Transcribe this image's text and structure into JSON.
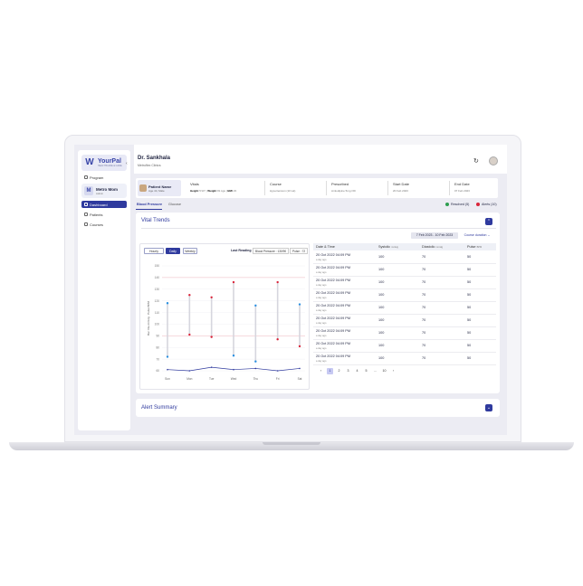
{
  "sidebar": {
    "logo_mark": "W",
    "logo_name": "YourPal",
    "logo_sub": "HEALTHCARE & CARE",
    "items": [
      {
        "label": "Program"
      },
      {
        "label": "Dashboard"
      },
      {
        "label": "Patients"
      },
      {
        "label": "Courses"
      }
    ],
    "org": {
      "initial": "M",
      "name": "Metro Mom",
      "sub": "Admin"
    }
  },
  "header": {
    "doctor": "Dr. Sankhala",
    "org": "Metroflex Clinics"
  },
  "patient": {
    "name": "Patient Name",
    "sub": "Age 44, Male",
    "vitals_label": "Vitals",
    "height_label": "Height",
    "height": "5'10\"",
    "weight_label": "Weight",
    "weight": "81 kgs",
    "bmi_label": "BMI",
    "bmi": "23",
    "course_label": "Course",
    "course": "Hypertension (10 wk)",
    "prescribed_label": "Prescribed",
    "prescribed": "Amlodipine 5mg OD",
    "start_label": "Start Date",
    "start": "20 Feb 2023",
    "end_label": "End Date",
    "end": "07 Feb 2023"
  },
  "tabs": {
    "bp": "Blood Pressure",
    "glucose": "Glucose"
  },
  "legend": {
    "resolved": "Resolved (5)",
    "alerts": "Alerts (10)",
    "resolved_color": "#2e9e4f",
    "alerts_color": "#d9253a"
  },
  "vitals": {
    "title": "Vital Trends",
    "date_range": "7 Feb 2023 - 10 Feb 2023",
    "course_duration": "Course duration",
    "segments": [
      "Hourly",
      "Daily",
      "Weekly"
    ],
    "last_reading_label": "Last Reading",
    "last_reading_bp": "Blood Pressure : 130/90",
    "last_reading_pulse": "Pulse : 72"
  },
  "chart_data": {
    "type": "line",
    "ylabel": "Bar: Dia mmHg · Pulse BPM",
    "y_ticks": [
      60,
      70,
      80,
      90,
      100,
      110,
      120,
      130,
      140,
      150
    ],
    "ylim": [
      60,
      150
    ],
    "categories": [
      "Sun",
      "Mon",
      "Tue",
      "Wed",
      "Thu",
      "Fri",
      "Sat"
    ],
    "systolic": [
      118,
      125,
      123,
      136,
      116,
      136,
      117
    ],
    "diastolic": [
      72,
      91,
      89,
      73,
      68,
      87,
      81
    ],
    "pulse": [
      61,
      60,
      63,
      61,
      62,
      60,
      62
    ],
    "thresholds": [
      140,
      90
    ],
    "colors": {
      "normal": "#2a8fe0",
      "alert": "#d9253a",
      "pulse": "#2f3a9e",
      "range": "#d6d6de"
    }
  },
  "table": {
    "headers": {
      "date": "Date & Time",
      "systolic": "Systolic",
      "diastolic": "Diastolic",
      "pulse": "Pulse",
      "unit": "mmHg",
      "pulse_unit": "BPM"
    },
    "rows": [
      {
        "date": "20 Oct 2022 04:09 PM",
        "ago": "a day ago",
        "sys": "100",
        "dia": "70",
        "pulse": "50"
      },
      {
        "date": "20 Oct 2022 04:09 PM",
        "ago": "a day ago",
        "sys": "100",
        "dia": "70",
        "pulse": "50"
      },
      {
        "date": "20 Oct 2022 04:09 PM",
        "ago": "a day ago",
        "sys": "100",
        "dia": "70",
        "pulse": "50"
      },
      {
        "date": "20 Oct 2022 04:09 PM",
        "ago": "a day ago",
        "sys": "100",
        "dia": "70",
        "pulse": "50"
      },
      {
        "date": "20 Oct 2022 04:09 PM",
        "ago": "a day ago",
        "sys": "100",
        "dia": "70",
        "pulse": "50"
      },
      {
        "date": "20 Oct 2022 04:09 PM",
        "ago": "a day ago",
        "sys": "100",
        "dia": "70",
        "pulse": "50"
      },
      {
        "date": "20 Oct 2022 04:09 PM",
        "ago": "a day ago",
        "sys": "100",
        "dia": "70",
        "pulse": "50"
      },
      {
        "date": "20 Oct 2022 04:09 PM",
        "ago": "a day ago",
        "sys": "100",
        "dia": "70",
        "pulse": "50"
      },
      {
        "date": "20 Oct 2022 04:09 PM",
        "ago": "a day ago",
        "sys": "100",
        "dia": "70",
        "pulse": "50"
      }
    ],
    "pages": [
      "1",
      "2",
      "3",
      "4",
      "5",
      "...",
      "10"
    ]
  },
  "alerts": {
    "title": "Alert Summary"
  }
}
